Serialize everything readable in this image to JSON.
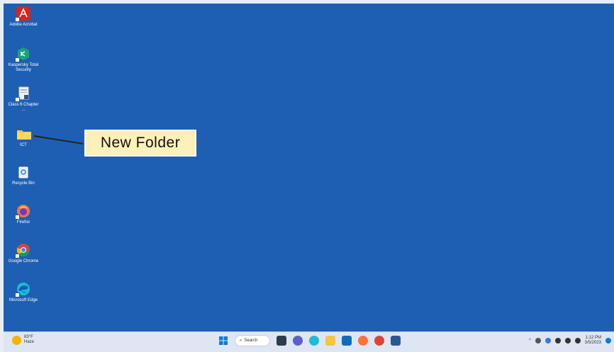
{
  "desktop": {
    "icons": [
      {
        "label": "Adobe Acrobat",
        "icon": "adobe-acrobat-icon"
      },
      {
        "label": "Kaspersky Total Security",
        "icon": "kaspersky-icon"
      },
      {
        "label": "Class 6 Chapter ...",
        "icon": "document-icon"
      },
      {
        "label": "ICT",
        "icon": "folder-icon"
      },
      {
        "label": "Recycle Bin",
        "icon": "recycle-bin-icon"
      },
      {
        "label": "Firefox",
        "icon": "firefox-icon"
      },
      {
        "label": "Google Chrome",
        "icon": "chrome-icon"
      },
      {
        "label": "Microsoft Edge",
        "icon": "edge-icon"
      }
    ]
  },
  "callout": {
    "text": "New  Folder"
  },
  "taskbar": {
    "weather": {
      "temp": "83°F",
      "condition": "Haze"
    },
    "search_label": "Search",
    "clock": {
      "time": "1:12 PM",
      "date": "3/5/2023"
    }
  }
}
